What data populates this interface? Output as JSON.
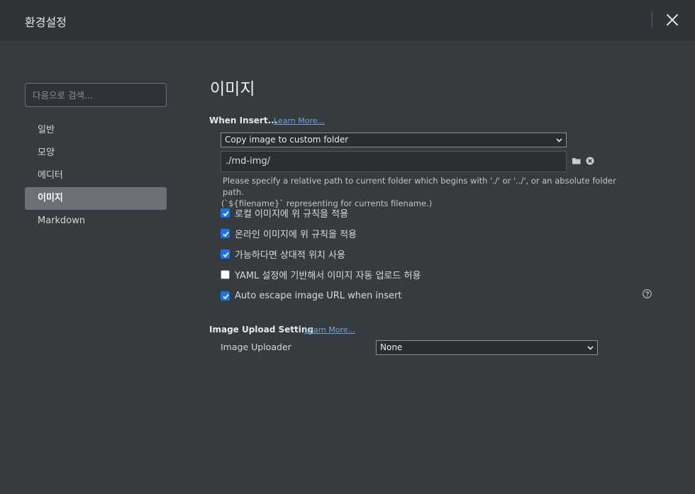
{
  "window": {
    "title": "환경설정"
  },
  "sidebar": {
    "search_placeholder": "다음으로 검색...",
    "items": [
      {
        "label": "일반",
        "active": false
      },
      {
        "label": "모양",
        "active": false
      },
      {
        "label": "에디터",
        "active": false
      },
      {
        "label": "이미지",
        "active": true
      },
      {
        "label": "Markdown",
        "active": false
      }
    ]
  },
  "main": {
    "title": "이미지",
    "when_insert": {
      "heading": "When Insert...",
      "learn_more": "Learn More...",
      "action_selected": "Copy image to custom folder",
      "path_value": "./md-img/",
      "hint_line1": "Please specify a relative path to current folder which begins with './' or '../', or an absolute folder path.",
      "hint_line2": "(`${filename}` representing for currents filename.)"
    },
    "options": [
      {
        "label": "로컬 이미지에 위 규칙을 적용",
        "checked": true
      },
      {
        "label": "온라인 이미지에 위 규칙을 적용",
        "checked": true
      },
      {
        "label": "가능하다면 상대적 위치 사용",
        "checked": true
      },
      {
        "label": "YAML 설정에 기반해서 이미지 자동 업로드 허용",
        "checked": false
      },
      {
        "label": "Auto escape image URL when insert",
        "checked": true
      }
    ],
    "upload": {
      "heading": "Image Upload Setting",
      "learn_more": "Learn More...",
      "uploader_label": "Image Uploader",
      "uploader_selected": "None"
    }
  },
  "colors": {
    "background": "#363b40",
    "titlebar": "#2f3338",
    "accent": "#1a73e8",
    "link": "#6fa6d9",
    "active_item": "#6c7079"
  }
}
